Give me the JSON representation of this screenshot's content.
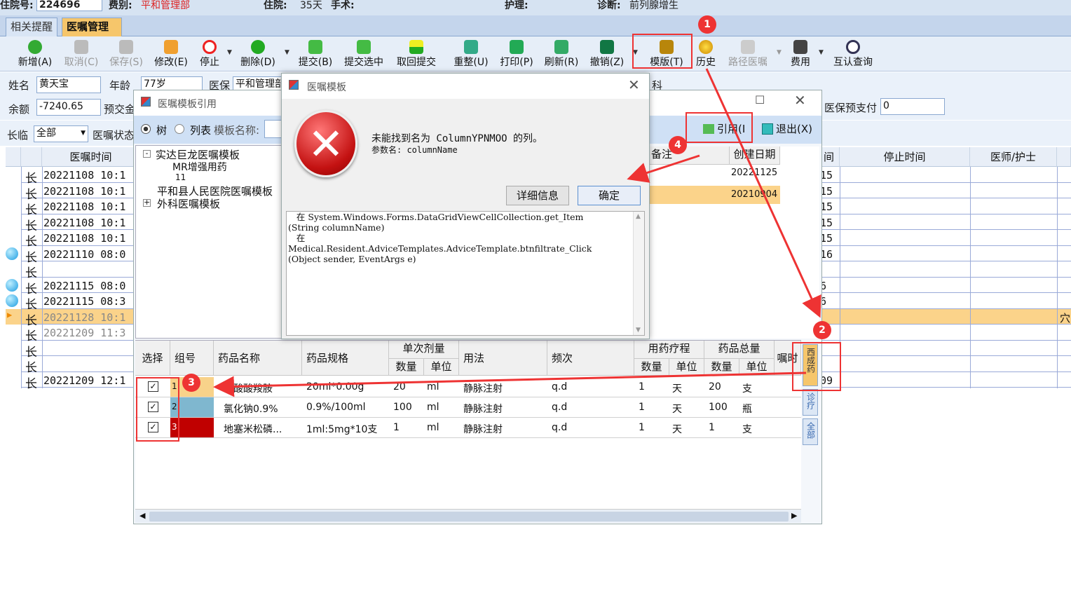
{
  "patient_bar": {
    "inpatient_no_label": "住院号:",
    "inpatient_no": "224696",
    "dept_label": "费别:",
    "dept_value": "平和管理部",
    "stay_label": "住院:",
    "stay_value": "35天",
    "surgery_label": "手术:",
    "nursing_label": "护理:",
    "diagnosis_label": "诊断:",
    "diagnosis_value": "前列腺增生"
  },
  "tabs": [
    "相关提醒",
    "医嘱管理"
  ],
  "toolbar": {
    "add": "新增(A)",
    "cancel": "取消(C)",
    "save": "保存(S)",
    "edit": "修改(E)",
    "stop": "停止",
    "delete": "删除(D)",
    "submit": "提交(B)",
    "submit_selected": "提交选中",
    "retract": "取回提交",
    "reorder": "重整(U)",
    "print": "打印(P)",
    "refresh": "刷新(R)",
    "revoke": "撤销(Z)",
    "template": "模版(T)",
    "history": "历史",
    "pathway": "路径医嘱",
    "fee": "费用",
    "mutual_query": "互认查询"
  },
  "info": {
    "name_label": "姓名",
    "name": "黄天宝",
    "age_label": "年龄",
    "age": "77岁",
    "insurance_label": "医保",
    "insurance": "平和管理部",
    "dept_tail": "科",
    "balance_label": "余额",
    "balance": "-7240.65",
    "prepay_label": "预交金",
    "ins_prepay_label": "医保预支付",
    "ins_prepay": "0"
  },
  "filter": {
    "type_label": "长临",
    "type_value": "全部",
    "status_label": "医嘱状态"
  },
  "grid": {
    "col_time": "医嘱时间",
    "col_stop_time": "停止时间",
    "col_doctor": "医师/护士",
    "col_partial": "间",
    "rows": [
      {
        "kind": "长",
        "time": "20221108 10:1",
        "end": "15"
      },
      {
        "kind": "长",
        "time": "20221108 10:1",
        "end": "15"
      },
      {
        "kind": "长",
        "time": "20221108 10:1",
        "end": "15"
      },
      {
        "kind": "长",
        "time": "20221108 10:1",
        "end": "15"
      },
      {
        "kind": "长",
        "time": "20221108 10:1",
        "end": "15"
      },
      {
        "kind": "长",
        "time": "20221110 08:0",
        "end": "16"
      },
      {
        "kind": "长",
        "time": "",
        "end": ""
      },
      {
        "kind": "长",
        "time": "20221115 08:0",
        "end": "6"
      },
      {
        "kind": "长",
        "time": "20221115 08:3",
        "end": "6"
      },
      {
        "kind": "长",
        "time": "20221128 10:1",
        "end": ""
      },
      {
        "kind": "长",
        "time": "20221209 11:3",
        "end": ""
      },
      {
        "kind": "长",
        "time": "",
        "end": ""
      },
      {
        "kind": "长",
        "time": "",
        "end": ""
      },
      {
        "kind": "长",
        "time": "20221209 12:1",
        "end": "09"
      }
    ],
    "highlight_tail": "穴"
  },
  "ref_window": {
    "title": "医嘱模板引用",
    "radio_tree": "树",
    "radio_list": "列表",
    "search_label": "模板名称:",
    "tree": [
      "实达巨龙医嘱模板",
      "MR增强用药",
      "11",
      "平和县人民医院医嘱模板",
      "外科医嘱模板"
    ],
    "btn_ref": "引用(I",
    "btn_exit": "退出(X)",
    "col_remark": "备注",
    "col_created": "创建日期",
    "created_rows": [
      "20221125",
      "20210904"
    ],
    "detail_headers": {
      "select": "选择",
      "group": "组号",
      "drug_name": "药品名称",
      "drug_spec": "药品规格",
      "single_dose": "单次剂量",
      "qty": "数量",
      "unit": "单位",
      "usage": "用法",
      "freq": "频次",
      "course": "用药疗程",
      "total": "药品总量",
      "note": "嘱时"
    },
    "detail_rows": [
      {
        "group": "1",
        "name": "乳酸酸羧胺",
        "spec": "20ml*0.00g",
        "dose": "20",
        "dose_unit": "ml",
        "usage": "静脉注射",
        "freq": "q.d",
        "course": "1",
        "course_unit": "天",
        "total": "20",
        "total_unit": "支",
        "color": "#f8d28a"
      },
      {
        "group": "2",
        "name": "氯化钠0.9%",
        "spec": "0.9%/100ml",
        "dose": "100",
        "dose_unit": "ml",
        "usage": "静脉注射",
        "freq": "q.d",
        "course": "1",
        "course_unit": "天",
        "total": "100",
        "total_unit": "瓶",
        "color": "#7fb7cf"
      },
      {
        "group": "3",
        "name": "地塞米松磷...",
        "spec": "1ml:5mg*10支",
        "dose": "1",
        "dose_unit": "ml",
        "usage": "静脉注射",
        "freq": "q.d",
        "course": "1",
        "course_unit": "天",
        "total": "1",
        "total_unit": "支",
        "color": "#c00000"
      }
    ],
    "side_tabs": [
      "西成药",
      "诊疗",
      "全部"
    ]
  },
  "dialog": {
    "title": "医嘱模板",
    "message": "未能找到名为 ColumnYPNMOO 的列。",
    "param": "参数名: columnName",
    "btn_detail": "详细信息",
    "btn_ok": "确定",
    "stack_lines": [
      "   在 System.Windows.Forms.DataGridViewCellCollection.get_Item",
      "(String columnName)",
      "   在",
      "Medical.Resident.AdviceTemplates.AdviceTemplate.btnfiltrate_Click",
      "(Object sender, EventArgs e)"
    ]
  },
  "annotations": [
    "1",
    "2",
    "3",
    "4"
  ],
  "colors": {
    "accent_red": "#e33333",
    "highlight_row": "#fbd38a",
    "selected_tab": "#f6c66b"
  }
}
